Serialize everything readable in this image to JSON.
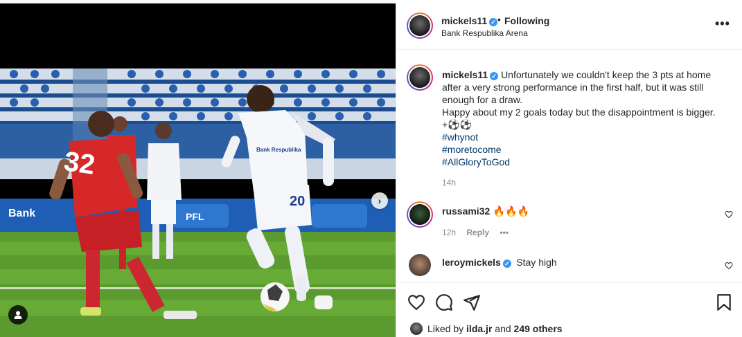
{
  "post": {
    "username": "mickels11",
    "follow_status": "Following",
    "separator": "•",
    "location": "Bank Respublika Arena",
    "more_label": "•••"
  },
  "caption": {
    "username": "mickels11",
    "lines": [
      "Unfortunately we couldn't keep the 3 pts at home after a very strong performance in the first half, but it was still enough for a draw.",
      "Happy about my 2 goals today but the disappointment is bigger.",
      "+⚽⚽"
    ],
    "hashtags": [
      "#whynot",
      "#moretocome",
      "#AllGloryToGod"
    ],
    "time": "14h"
  },
  "comments": [
    {
      "username": "russami32",
      "text": "🔥🔥🔥",
      "time": "12h",
      "reply_label": "Reply",
      "more_label": "•••"
    },
    {
      "username": "leroymickels",
      "text": "Stay high",
      "verified": true
    }
  ],
  "likes": {
    "prefix": "Liked by",
    "user": "ilda.jr",
    "joiner": "and",
    "others": "249 others"
  },
  "photo": {
    "jersey_number_red": "32",
    "jersey_number_white": "20",
    "sponsor_text": "Bank Respublika",
    "board_text": "PFL"
  },
  "icons": {
    "verified": "verified-badge-icon",
    "heart": "heart-icon",
    "comment": "comment-icon",
    "share": "share-icon",
    "bookmark": "bookmark-icon",
    "next": "chevron-right-icon",
    "tag": "user-tag-icon"
  },
  "colors": {
    "link": "#00376b",
    "verified": "#3897f0",
    "muted": "#8e8e8e",
    "border": "#efefef"
  }
}
